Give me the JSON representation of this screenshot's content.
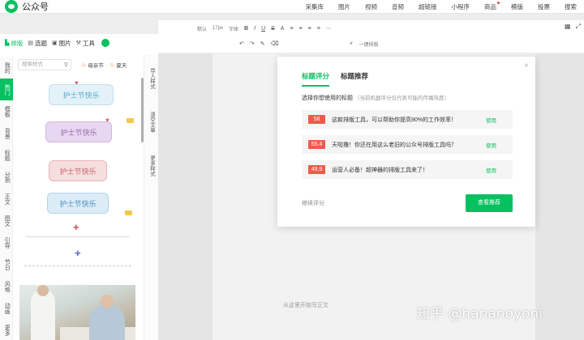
{
  "app": {
    "title": "公众号"
  },
  "topnav": [
    "采集库",
    "图片",
    "视频",
    "音频",
    "超链接",
    "小程序",
    "商品",
    "模版",
    "投票",
    "搜索"
  ],
  "leftpanel": {
    "tabs": [
      {
        "label": "排版",
        "icon": "layout-icon",
        "active": true
      },
      {
        "label": "选题",
        "icon": "topic-icon"
      },
      {
        "label": "图片",
        "icon": "image-icon"
      },
      {
        "label": "工具",
        "icon": "tool-icon"
      }
    ],
    "categories": [
      "我的",
      "热门",
      "模板",
      "背景",
      "标题",
      "分割",
      "正文",
      "图文",
      "引导",
      "节日",
      "风格",
      "动画",
      "更多"
    ],
    "search": {
      "placeholder": "搜索样式"
    },
    "chips": [
      "母亲节",
      "夏天"
    ],
    "side_tools": [
      "导入样式",
      "清空文章",
      "更多样式"
    ],
    "banners": [
      "护士节快乐",
      "护士节快乐",
      "护士节快乐",
      "护士节快乐"
    ]
  },
  "toolbar": {
    "row1": [
      "默认",
      "17px",
      "字体",
      "B",
      "I",
      "U",
      "S",
      "A",
      "≡",
      "≡",
      "≡",
      "≡",
      "⋯"
    ],
    "row2_label": "一键排版"
  },
  "editor": {
    "placeholder": "从这里开始写正文"
  },
  "modal": {
    "tabs": [
      "标题评分",
      "标题推荐"
    ],
    "desc": "选择你想使用的标题",
    "hint": "（当前机器评分仅代表可能的传播热度）",
    "rows": [
      {
        "score": "58",
        "text": "这款排版工具，可以帮助你提高90%的工作效率！",
        "action": "使用"
      },
      {
        "score": "55.4",
        "text": "天啦撸！你还在用这么老旧的公众号排版工具吗？",
        "action": "使用"
      },
      {
        "score": "49.9",
        "text": "运营人必备！超神器的排版工具来了！",
        "action": "使用"
      }
    ],
    "skip": "继续评分",
    "primary": "查看推荐",
    "close": "×"
  },
  "watermark": "知乎 @hananoyoni",
  "colors": {
    "accent": "#07c160",
    "score": "#f15a4a"
  }
}
